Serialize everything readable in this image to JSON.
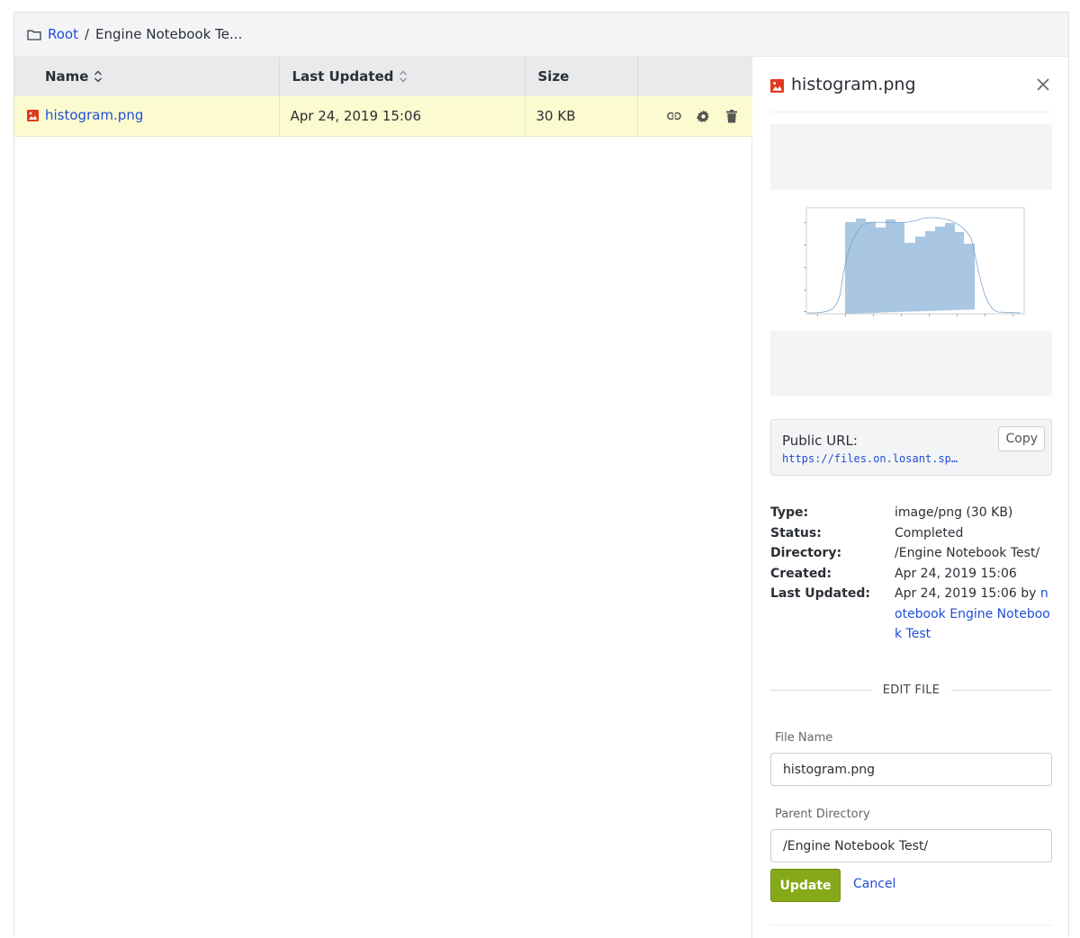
{
  "breadcrumb": {
    "root_label": "Root",
    "separator": "/",
    "current": "Engine Notebook Te..."
  },
  "table": {
    "columns": [
      "Name",
      "Last Updated",
      "Size"
    ],
    "rows": [
      {
        "name": "histogram.png",
        "last_updated": "Apr 24, 2019 15:06",
        "size": "30 KB",
        "icons": [
          "link-icon",
          "gear-icon",
          "trash-icon"
        ]
      }
    ]
  },
  "panel": {
    "title": "histogram.png",
    "public_url_label": "Public URL:",
    "public_url": "https://files.on.losant.sp…",
    "copy_label": "Copy",
    "meta": {
      "type_key": "Type:",
      "type_val": "image/png (30 KB)",
      "status_key": "Status:",
      "status_val": "Completed",
      "directory_key": "Directory:",
      "directory_val": "/Engine Notebook Test/",
      "created_key": "Created:",
      "created_val": "Apr 24, 2019 15:06",
      "updated_key": "Last Updated:",
      "updated_val": "Apr 24, 2019 15:06 by ",
      "updated_link": "notebook Engine Notebook Test"
    },
    "edit_heading": "EDIT FILE",
    "file_name_label": "File Name",
    "file_name_value": "histogram.png",
    "parent_dir_label": "Parent Directory",
    "parent_dir_value": "/Engine Notebook Test/",
    "update_label": "Update",
    "cancel_label": "Cancel"
  },
  "colors": {
    "link": "#1f4ed8",
    "selected_row": "#fcfbcf",
    "update_button": "#86a91a",
    "image_icon": "#e03a1e"
  }
}
